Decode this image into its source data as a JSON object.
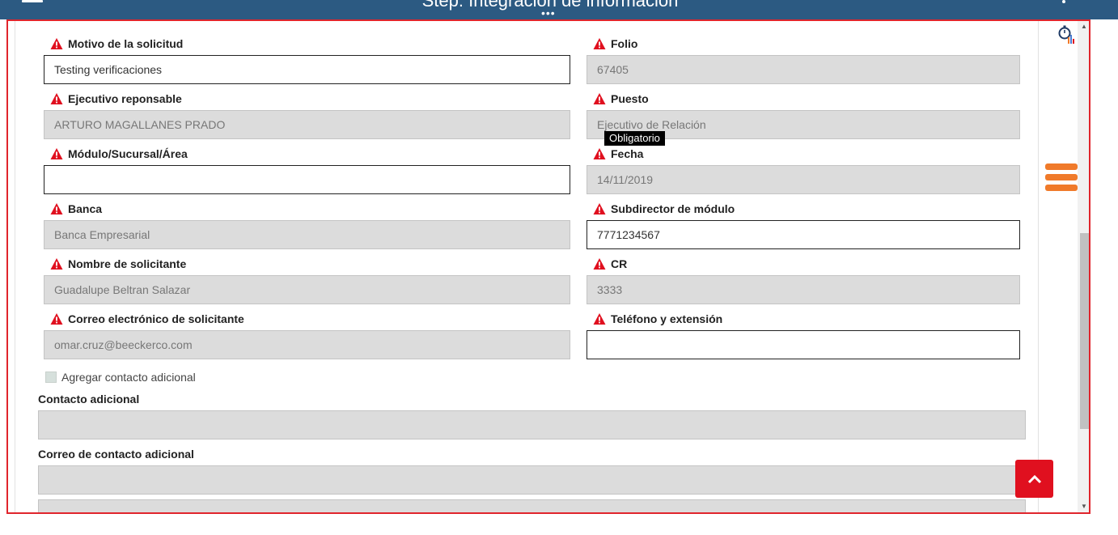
{
  "header": {
    "title": "Step: Integración de información"
  },
  "form": {
    "left": [
      {
        "label": "Motivo de la solicitud",
        "value": "Testing verificaciones",
        "editable": true
      },
      {
        "label": "Ejecutivo reponsable",
        "value": "ARTURO MAGALLANES PRADO",
        "editable": false
      },
      {
        "label": "Módulo/Sucursal/Área",
        "value": "",
        "editable": true
      },
      {
        "label": "Banca",
        "value": "Banca Empresarial",
        "editable": false
      },
      {
        "label": "Nombre de solicitante",
        "value": "Guadalupe Beltran Salazar",
        "editable": false
      },
      {
        "label": "Correo electrónico de solicitante",
        "value": "omar.cruz@beeckerco.com",
        "editable": false
      }
    ],
    "right": [
      {
        "label": "Folio",
        "value": "67405",
        "editable": false
      },
      {
        "label": "Puesto",
        "value": "Ejecutivo de Relación",
        "editable": false
      },
      {
        "label": "Fecha",
        "value": "14/11/2019",
        "editable": false
      },
      {
        "label": "Subdirector de módulo",
        "value": "7771234567",
        "editable": true
      },
      {
        "label": "CR",
        "value": "3333",
        "editable": false
      },
      {
        "label": "Teléfono y extensión",
        "value": "",
        "editable": true
      }
    ],
    "tooltip": "Obligatorio",
    "checkbox_label": "Agregar contacto adicional",
    "contacto_label": "Contacto adicional",
    "contacto_value": "",
    "correo_contacto_label": "Correo de contacto adicional",
    "correo_contacto_value": ""
  },
  "colors": {
    "header_bg": "#2c5a82",
    "frame_border": "#e0252c",
    "warning": "#e0101f",
    "menu_orange": "#f07a2a",
    "back_to_top": "#e0101f"
  },
  "icons": {
    "required": "warning-triangle-icon",
    "timer": "stopwatch-chart-icon",
    "menu": "hamburger-icon",
    "back_top": "chevron-up-icon"
  }
}
